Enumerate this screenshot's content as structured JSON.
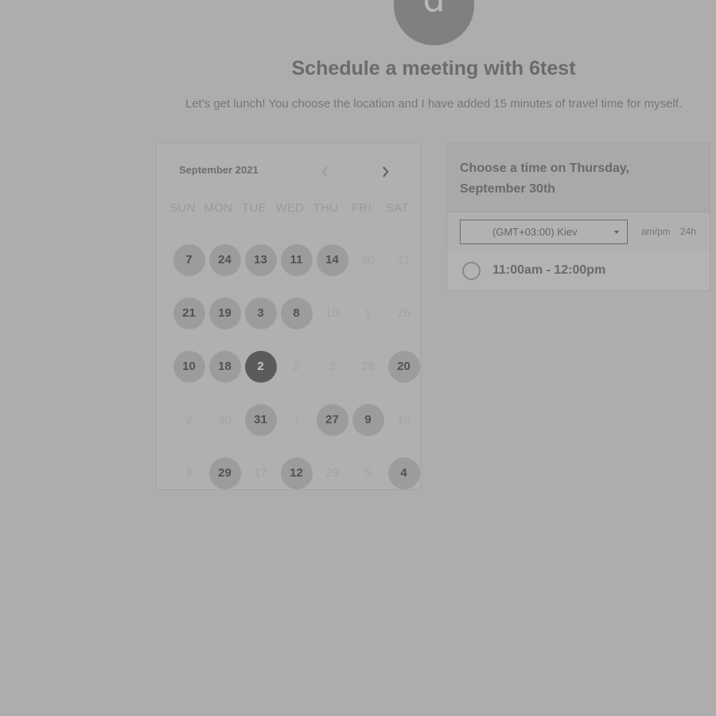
{
  "avatar": {
    "initial": "d"
  },
  "header": {
    "title": "Schedule a meeting with 6test",
    "description": "Let’s get lunch! You choose the location and I have added 15 minutes of travel time for myself."
  },
  "calendar": {
    "month_label": "September 2021",
    "weekdays": [
      "SUN",
      "MON",
      "TUE",
      "WED",
      "THU",
      "FRI",
      "SAT"
    ],
    "weeks": [
      [
        {
          "label": "7",
          "state": "avail"
        },
        {
          "label": "24",
          "state": "avail"
        },
        {
          "label": "13",
          "state": "avail"
        },
        {
          "label": "11",
          "state": "avail"
        },
        {
          "label": "14",
          "state": "avail"
        },
        {
          "label": "30",
          "state": "dim"
        },
        {
          "label": "11",
          "state": "dim"
        }
      ],
      [
        {
          "label": "21",
          "state": "avail"
        },
        {
          "label": "19",
          "state": "avail"
        },
        {
          "label": "3",
          "state": "avail"
        },
        {
          "label": "8",
          "state": "avail"
        },
        {
          "label": "10",
          "state": "dim"
        },
        {
          "label": "1",
          "state": "dim"
        },
        {
          "label": "26",
          "state": "dim"
        }
      ],
      [
        {
          "label": "10",
          "state": "avail"
        },
        {
          "label": "18",
          "state": "avail"
        },
        {
          "label": "2",
          "state": "selected"
        },
        {
          "label": "2",
          "state": "dim"
        },
        {
          "label": "3",
          "state": "dim"
        },
        {
          "label": "26",
          "state": "dim"
        },
        {
          "label": "20",
          "state": "avail"
        }
      ],
      [
        {
          "label": "2",
          "state": "dim"
        },
        {
          "label": "30",
          "state": "dim"
        },
        {
          "label": "31",
          "state": "avail"
        },
        {
          "label": "7",
          "state": "dim"
        },
        {
          "label": "27",
          "state": "avail"
        },
        {
          "label": "9",
          "state": "avail"
        },
        {
          "label": "10",
          "state": "dim"
        }
      ],
      [
        {
          "label": "8",
          "state": "dim"
        },
        {
          "label": "29",
          "state": "avail"
        },
        {
          "label": "17",
          "state": "dim"
        },
        {
          "label": "12",
          "state": "avail"
        },
        {
          "label": "29",
          "state": "dim"
        },
        {
          "label": "5",
          "state": "dim"
        },
        {
          "label": "4",
          "state": "avail"
        }
      ]
    ]
  },
  "time_panel": {
    "heading": "Choose a time on Thursday, September 30th",
    "timezone": "(GMT+03:00) Kiev",
    "format_ampm": "am/pm",
    "format_24h": "24h",
    "slots": [
      {
        "label": "11:00am - 12:00pm"
      }
    ]
  },
  "colors": {
    "background": "#adadad",
    "selected_day": "#5b5b5b",
    "available_day": "#9c9c9c"
  }
}
